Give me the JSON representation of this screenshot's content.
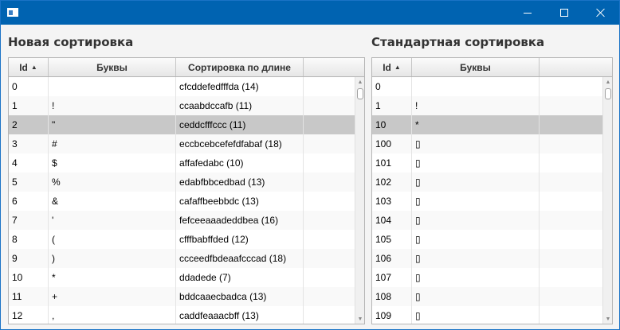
{
  "window": {
    "icons": {
      "app": "window-icon",
      "minimize": "minimize-icon",
      "maximize": "maximize-icon",
      "close": "close-icon"
    },
    "colors": {
      "titlebar": "#0063b1",
      "selection": "#c8c8c8"
    }
  },
  "left": {
    "title": "Новая сортировка",
    "columns": {
      "id": "Id",
      "letters": "Буквы",
      "by_length": "Сортировка по длине"
    },
    "sort_icon": "▲",
    "rows": [
      {
        "id": "0",
        "letter": "",
        "sorted": "cfcddefedfffda (14)"
      },
      {
        "id": "1",
        "letter": "!",
        "sorted": "ccaabdccafb (11)"
      },
      {
        "id": "2",
        "letter": "\"",
        "sorted": "ceddcfffccc (11)"
      },
      {
        "id": "3",
        "letter": "#",
        "sorted": "eccbcebcefefdfabaf (18)"
      },
      {
        "id": "4",
        "letter": "$",
        "sorted": "affafedabc (10)"
      },
      {
        "id": "5",
        "letter": "%",
        "sorted": "edabfbbcedbad (13)"
      },
      {
        "id": "6",
        "letter": "&",
        "sorted": "cafaffbeebbdc (13)"
      },
      {
        "id": "7",
        "letter": "'",
        "sorted": "fefceeaaadeddbea (16)"
      },
      {
        "id": "8",
        "letter": "(",
        "sorted": "cfffbabffded (12)"
      },
      {
        "id": "9",
        "letter": ")",
        "sorted": "ccceedfbdeaafcccad (18)"
      },
      {
        "id": "10",
        "letter": "*",
        "sorted": "ddadede (7)"
      },
      {
        "id": "11",
        "letter": "+",
        "sorted": "bddcaaecbadca (13)"
      },
      {
        "id": "12",
        "letter": ",",
        "sorted": "caddfeaaacbff (13)"
      }
    ]
  },
  "right": {
    "title": "Стандартная сортировка",
    "columns": {
      "id": "Id",
      "letters": "Буквы"
    },
    "sort_icon": "▲",
    "rows": [
      {
        "id": "0",
        "letter": ""
      },
      {
        "id": "1",
        "letter": "!"
      },
      {
        "id": "10",
        "letter": "*"
      },
      {
        "id": "100",
        "letter": "▯"
      },
      {
        "id": "101",
        "letter": "▯"
      },
      {
        "id": "102",
        "letter": "▯"
      },
      {
        "id": "103",
        "letter": "▯"
      },
      {
        "id": "104",
        "letter": "▯"
      },
      {
        "id": "105",
        "letter": "▯"
      },
      {
        "id": "106",
        "letter": "▯"
      },
      {
        "id": "107",
        "letter": "▯"
      },
      {
        "id": "108",
        "letter": "▯"
      },
      {
        "id": "109",
        "letter": "▯"
      }
    ]
  },
  "scrollbar": {
    "up_arrow": "▲",
    "down_arrow": "▼"
  }
}
